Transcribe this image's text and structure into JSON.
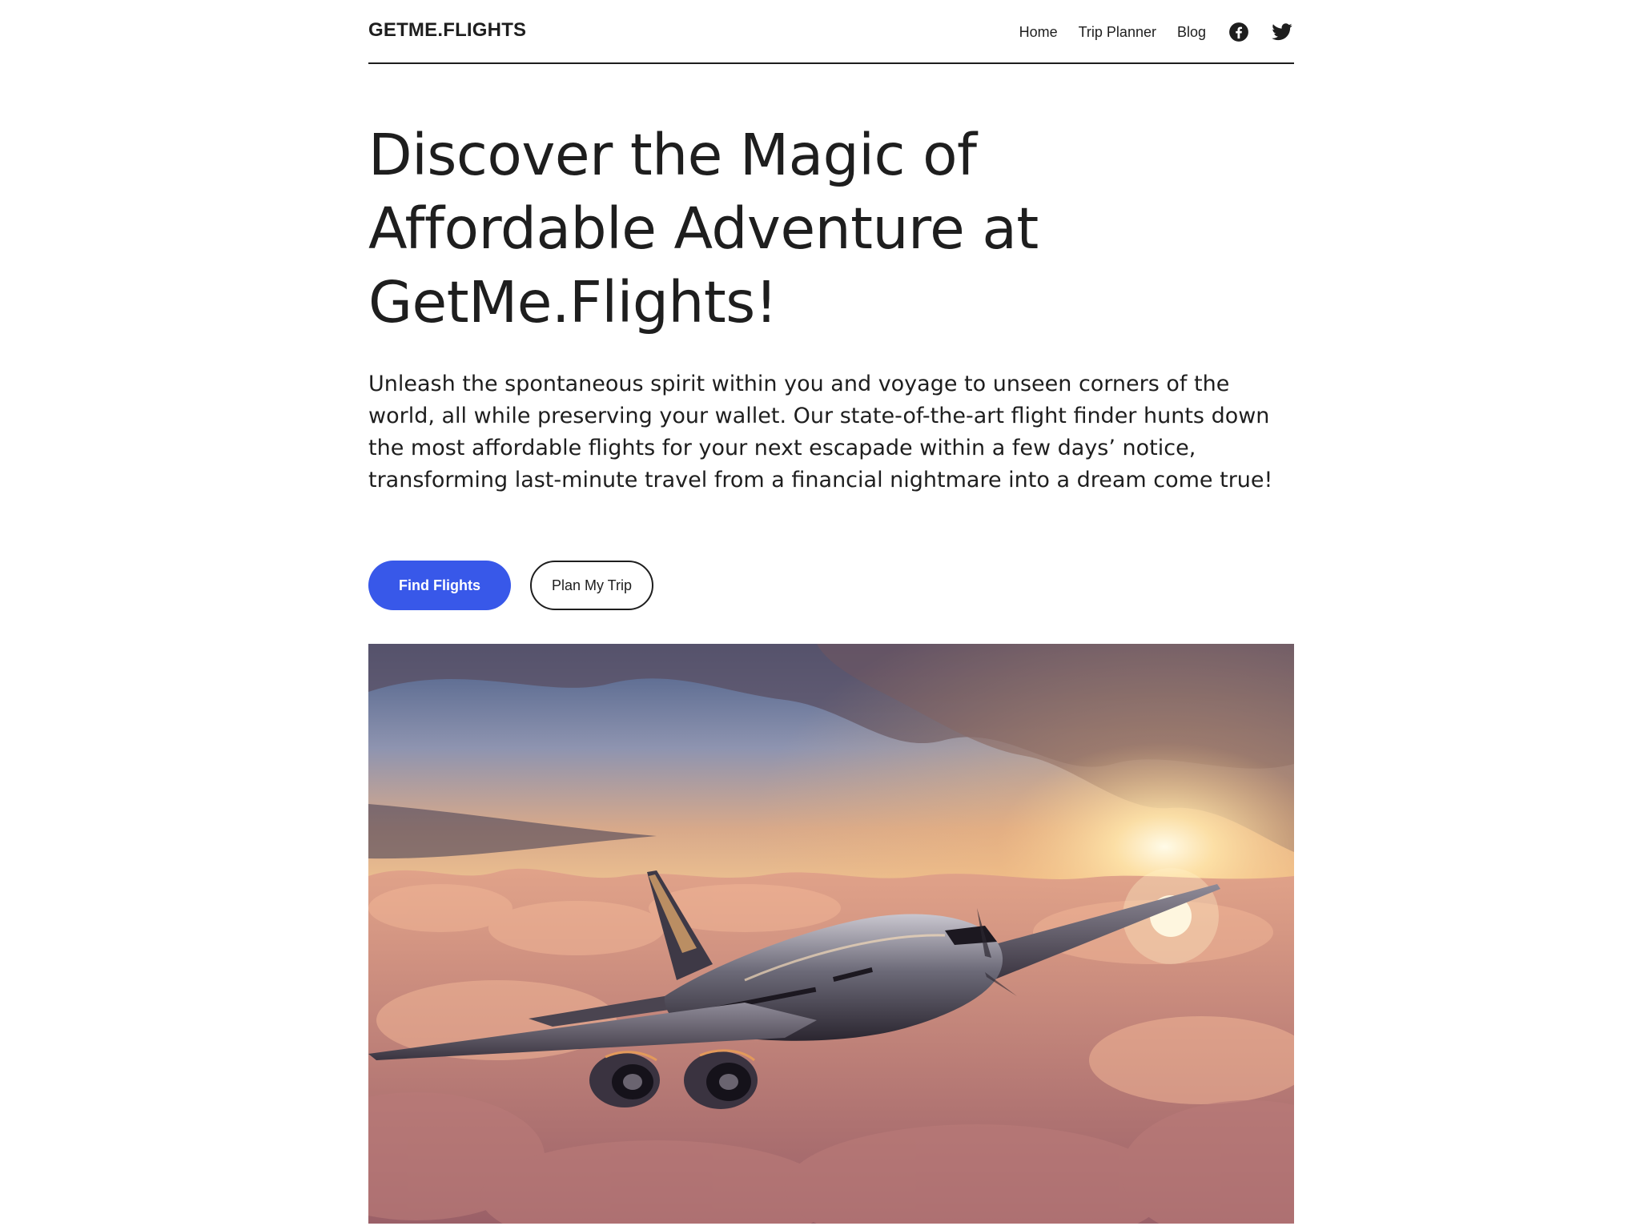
{
  "header": {
    "logo": "GETME.FLIGHTS",
    "nav": [
      {
        "label": "Home"
      },
      {
        "label": "Trip Planner"
      },
      {
        "label": "Blog"
      }
    ],
    "social": [
      {
        "icon": "facebook-icon"
      },
      {
        "icon": "twitter-icon"
      }
    ]
  },
  "hero": {
    "title": "Discover the Magic of\nAffordable Adventure at\nGetMe.Flights!",
    "text": "Unleash the spontaneous spirit within you and voyage to unseen corners of the world, all while preserving your wallet. Our state-of-the-art flight finder hunts down the most affordable flights for your next escapade within a few days’ notice, transforming last-minute travel from a financial nightmare into a dream come true!",
    "primary_button": "Find Flights",
    "secondary_button": "Plan My Trip",
    "image_alt": "airplane-above-clouds-at-sunset"
  },
  "colors": {
    "accent": "#3858e9",
    "text": "#1e1e1e",
    "background": "#ffffff"
  }
}
